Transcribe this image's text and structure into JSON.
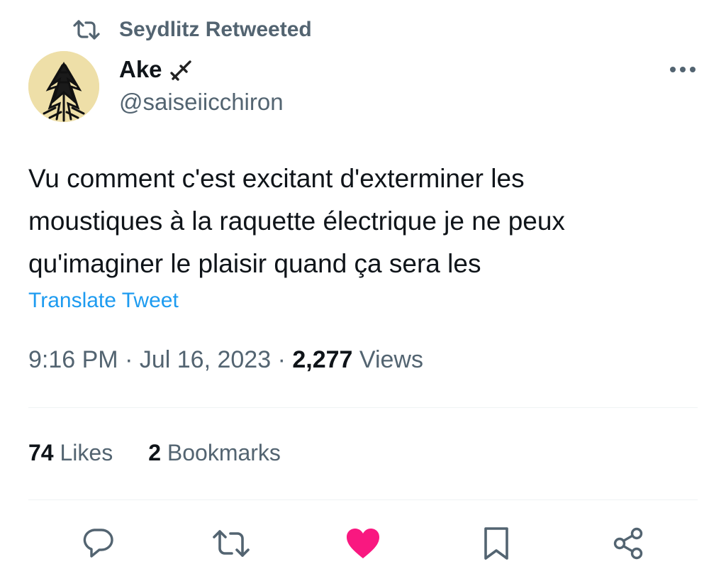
{
  "retweet_header": {
    "label": "Seydlitz Retweeted",
    "icon": "retweet-icon"
  },
  "author": {
    "name": "Ake",
    "emoji": "sword-emoji",
    "handle": "@saiseiicchiron",
    "avatar_bg": "#eedfa8"
  },
  "tweet": {
    "lines": [
      "Vu comment c'est excitant d'exterminer les",
      "moustiques à la raquette électrique je ne peux",
      "qu'imaginer le plaisir quand ça sera les"
    ],
    "translate_label": "Translate Tweet"
  },
  "meta": {
    "time": "9:16 PM",
    "sep1": "·",
    "date": "Jul 16, 2023",
    "sep2": "·",
    "views_count": "2,277",
    "views_label": "Views"
  },
  "stats": {
    "likes_count": "74",
    "likes_label": "Likes",
    "bookmarks_count": "2",
    "bookmarks_label": "Bookmarks"
  },
  "actions": [
    {
      "icon": "reply-icon"
    },
    {
      "icon": "retweet-icon"
    },
    {
      "icon": "heart-icon",
      "active": true,
      "color": "#f91880"
    },
    {
      "icon": "bookmark-icon"
    },
    {
      "icon": "share-icon"
    }
  ],
  "colors": {
    "text_primary": "#0f1419",
    "text_secondary": "#536471",
    "link": "#1d9bf0",
    "like_active": "#f91880",
    "divider": "#eff3f4"
  }
}
